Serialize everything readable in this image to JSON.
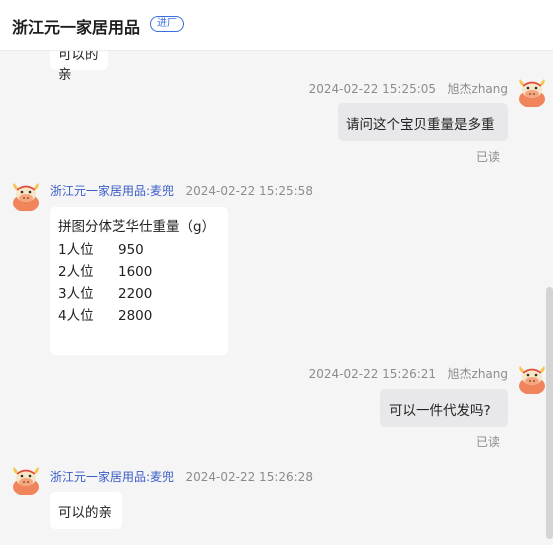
{
  "header": {
    "shop_name": "浙江元一家居用品",
    "badge": "进厂"
  },
  "messages": {
    "partial_top": {
      "text": "可以的亲"
    },
    "m1": {
      "timestamp": "2024-02-22 15:25:05",
      "sender": "旭杰zhang",
      "text": "请问这个宝贝重量是多重",
      "status": "已读"
    },
    "m2": {
      "sender": "浙江元一家居用品:麦兜",
      "timestamp": "2024-02-22 15:25:58",
      "title": "拼图分体芝华仕重量（g）",
      "rows": [
        {
          "label": "1人位",
          "value": "950"
        },
        {
          "label": "2人位",
          "value": "1600"
        },
        {
          "label": "3人位",
          "value": "2200"
        },
        {
          "label": "4人位",
          "value": "2800"
        }
      ]
    },
    "m3": {
      "timestamp": "2024-02-22 15:26:21",
      "sender": "旭杰zhang",
      "text": "可以一件代发吗?",
      "status": "已读"
    },
    "m4": {
      "sender": "浙江元一家居用品:麦兜",
      "timestamp": "2024-02-22 15:26:28",
      "text": "可以的亲"
    }
  },
  "colors": {
    "accent": "#3a6fe0",
    "avatar_orange": "#f08a5a"
  },
  "icons": {
    "avatar": "cow-avatar-icon"
  }
}
